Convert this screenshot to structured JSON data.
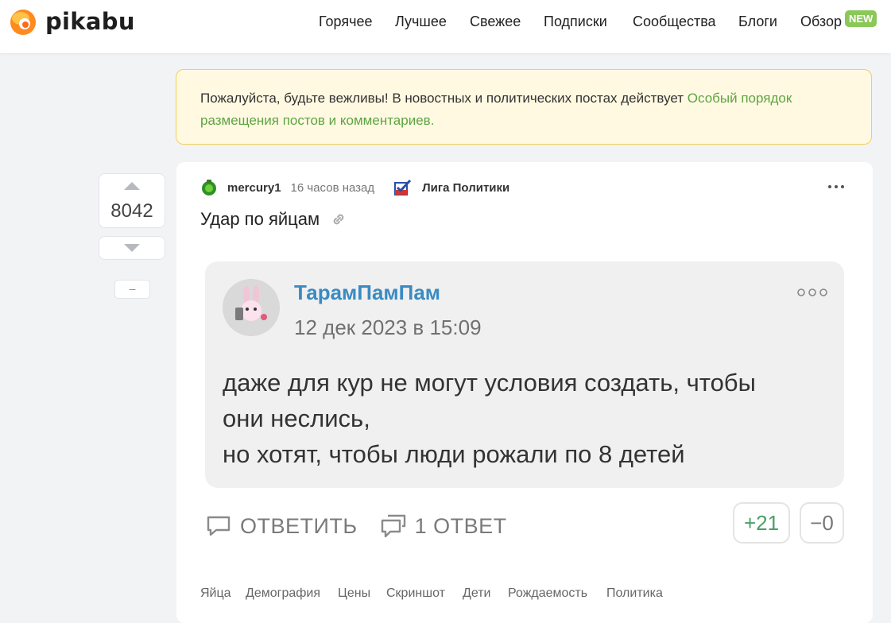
{
  "header": {
    "logo_text": "pikabu",
    "nav": [
      "Горячее",
      "Лучшее",
      "Свежее",
      "Подписки",
      "Сообщества",
      "Блоги",
      "Обзор"
    ],
    "new_badge": "NEW"
  },
  "notice": {
    "text": "Пожалуйста, будьте вежливы! В новостных и политических постах действует ",
    "link": "Особый порядок размещения постов и комментариев."
  },
  "vote": {
    "rating": "8042",
    "minus_label": "–"
  },
  "story": {
    "author": "mercury1",
    "time": "16 часов назад",
    "community": "Лига Политики",
    "title": "Удар по яйцам",
    "screenshot": {
      "author": "ТарамПамПам",
      "date": "12 дек 2023 в 15:09",
      "lines": [
        "даже для кур не могут условия создать, чтобы",
        "они неслись,",
        "но хотят, чтобы люди рожали по 8 детей"
      ],
      "reply_label": "ОТВЕТИТЬ",
      "replies_label": "1 ОТВЕТ",
      "plus_votes": "+21",
      "minus_votes": "−0"
    },
    "tags": [
      "Яйца",
      "Демография",
      "Цены",
      "Скриншот",
      "Дети",
      "Рождаемость",
      "Политика"
    ]
  },
  "colors": {
    "accent_green": "#8ac858",
    "link_green": "#5da443",
    "notice_bg": "#fff9e1",
    "screenshot_author": "#3a8bc1"
  }
}
